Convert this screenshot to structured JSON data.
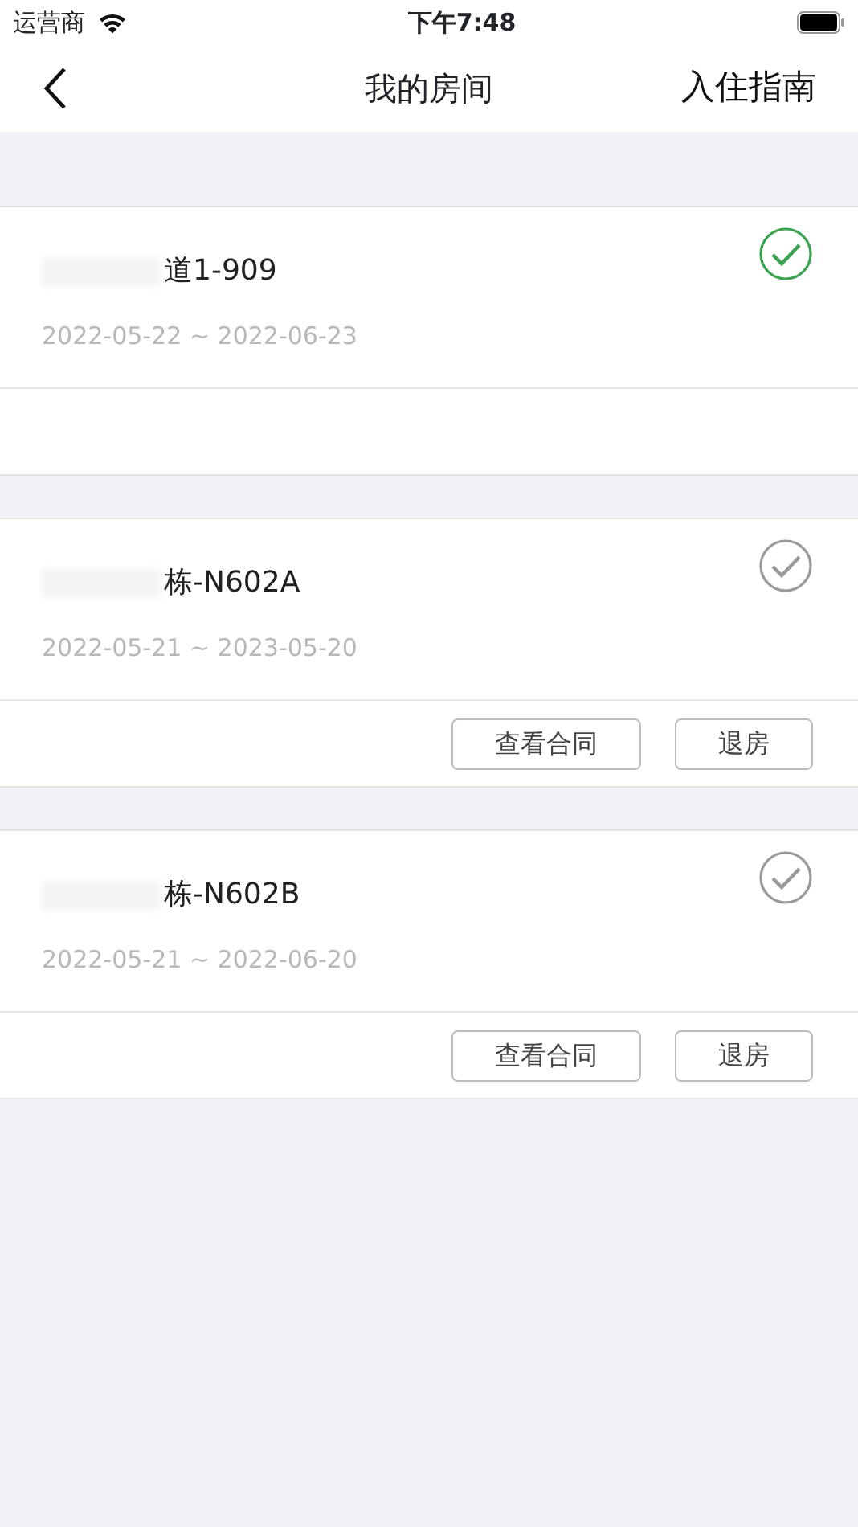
{
  "status_bar": {
    "carrier": "运营商",
    "time": "下午7:48"
  },
  "nav": {
    "title": "我的房间",
    "action": "入住指南"
  },
  "rooms": [
    {
      "name_redacted": true,
      "name": "道1-909",
      "dates": "2022-05-22 ~ 2022-06-23",
      "selected": true
    },
    {
      "name_redacted": true,
      "name": "栋-N602A",
      "dates": "2022-05-21 ~ 2023-05-20",
      "selected": false,
      "buttons": [
        "查看合同",
        "退房"
      ]
    },
    {
      "name_redacted": true,
      "name": "栋-N602B",
      "dates": "2022-05-21 ~ 2022-06-20",
      "selected": false,
      "buttons": [
        "查看合同",
        "退房"
      ]
    }
  ]
}
